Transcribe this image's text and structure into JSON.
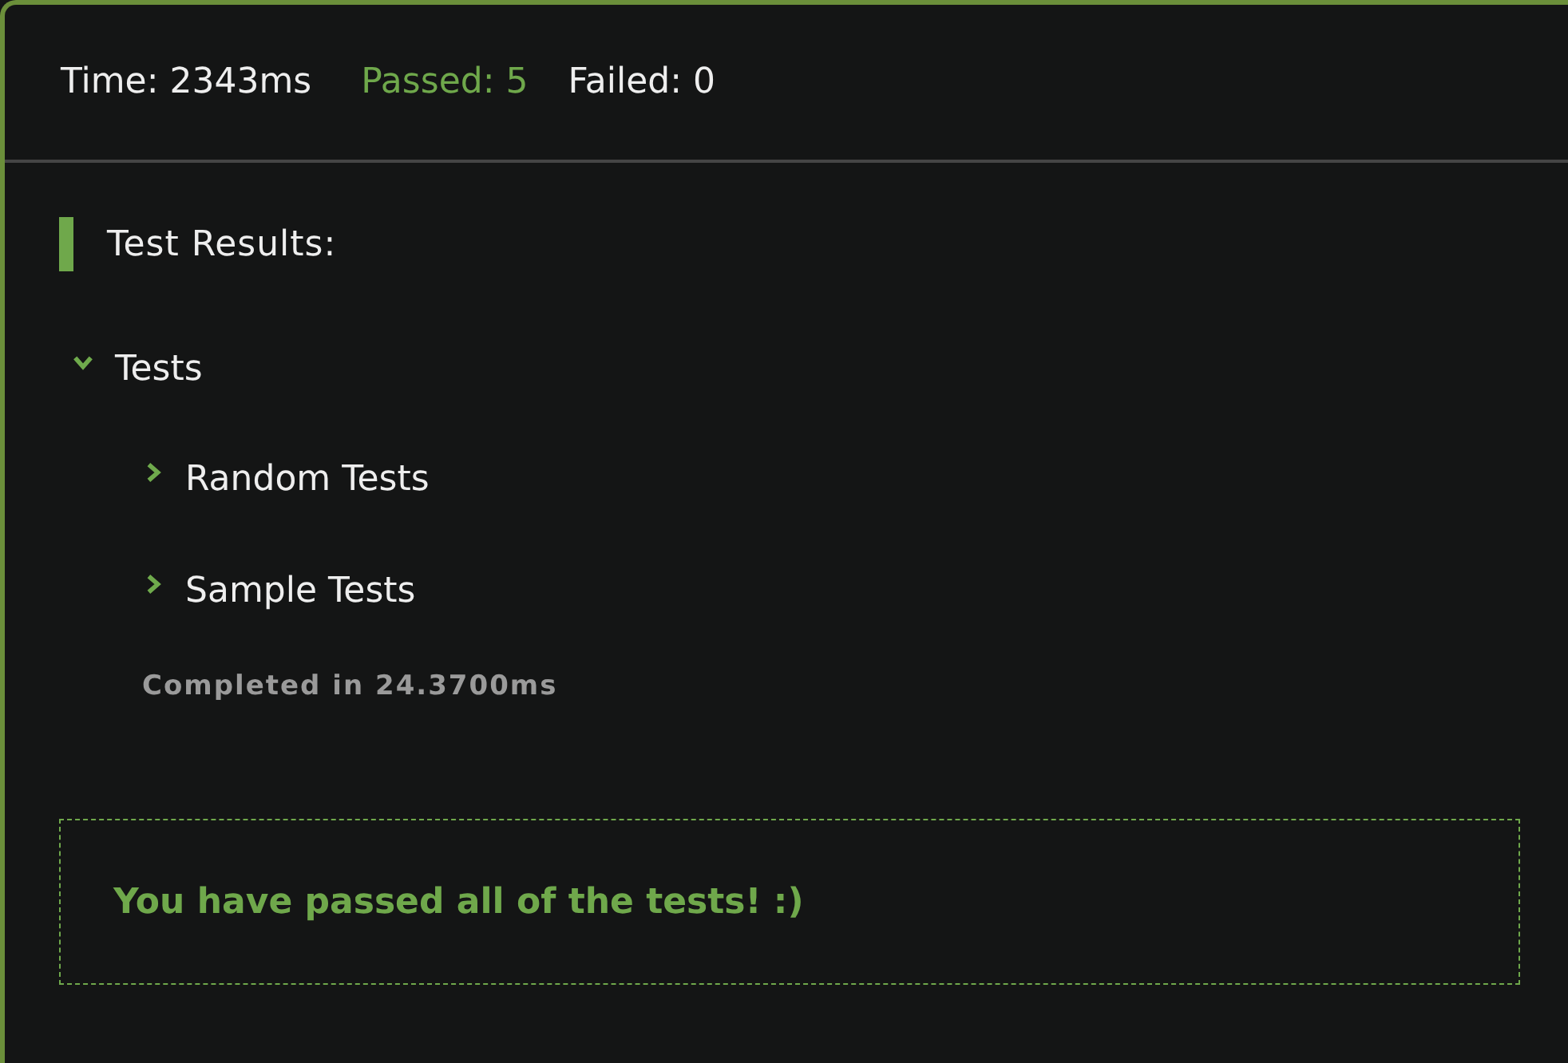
{
  "header": {
    "stats": [
      {
        "kind": "time",
        "text": "Time: 2343ms"
      },
      {
        "kind": "passed",
        "text": "Passed: 5"
      },
      {
        "kind": "failed",
        "text": "Failed: 0"
      }
    ]
  },
  "results": {
    "title": "Test Results:",
    "tree": [
      {
        "label": "Tests",
        "expanded": true,
        "children": [
          {
            "label": "Random Tests",
            "expanded": false
          },
          {
            "label": "Sample Tests",
            "expanded": false
          }
        ]
      }
    ],
    "completed": "Completed in 24.3700ms"
  },
  "message": "You have passed all of the tests! :)"
}
